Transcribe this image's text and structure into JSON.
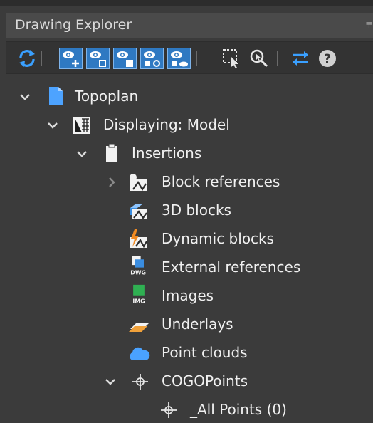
{
  "panel": {
    "title": "Drawing Explorer"
  },
  "toolbar": {
    "buttons": [
      "refresh-icon",
      "eye-add-icon",
      "eye-select-icon",
      "eye-filled-icon",
      "eye-refresh-icon",
      "eye-cloud-icon",
      "select-window-icon",
      "zoom-to-icon",
      "swap-arrows-icon",
      "help-icon"
    ]
  },
  "tree": {
    "root": {
      "label": "Topoplan"
    },
    "displaying": {
      "label": "Displaying: Model"
    },
    "insertions": {
      "label": "Insertions"
    },
    "block_references": {
      "label": "Block references"
    },
    "blocks_3d": {
      "label": "3D blocks"
    },
    "dynamic_blocks": {
      "label": "Dynamic blocks"
    },
    "external_references": {
      "label": "External references"
    },
    "images": {
      "label": "Images"
    },
    "underlays": {
      "label": "Underlays"
    },
    "point_clouds": {
      "label": "Point clouds"
    },
    "cogo_points": {
      "label": "COGOPoints"
    },
    "all_points": {
      "label": "_All Points (0)"
    }
  },
  "colors": {
    "accent": "#2f79c2",
    "background": "#3b3b3b",
    "toolbar": "#333333"
  }
}
